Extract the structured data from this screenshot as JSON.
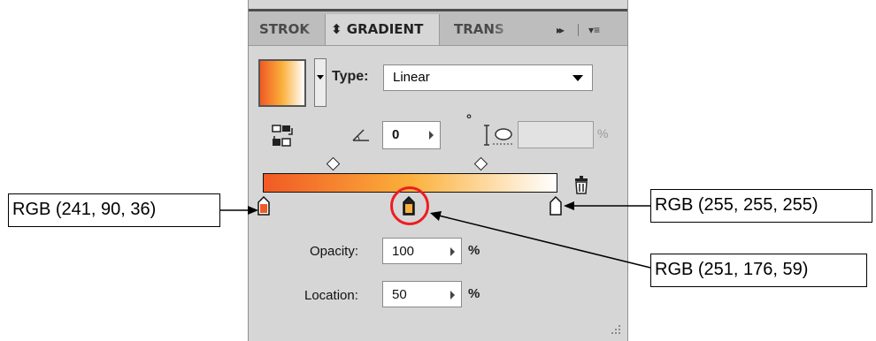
{
  "panel": {
    "tabs": [
      {
        "label": "STROK"
      },
      {
        "label": "⬍ GRADIENT"
      },
      {
        "label": "TRANS"
      }
    ],
    "icons": {
      "expand": "double-right-arrow-icon",
      "menu": "panel-menu-icon"
    }
  },
  "type_row": {
    "label": "Type:",
    "value": "Linear"
  },
  "angle_row": {
    "angle_value": "0",
    "degree_symbol": "°",
    "aspect_value": "",
    "aspect_unit": "%"
  },
  "gradient": {
    "stops": [
      {
        "color": "#f15a24",
        "location": 0
      },
      {
        "color": "#fbb03b",
        "location": 50,
        "selected": true
      },
      {
        "color": "#ffffff",
        "location": 100
      }
    ],
    "midpoints": [
      50,
      50
    ]
  },
  "opacity": {
    "label": "Opacity:",
    "value": "100",
    "unit": "%"
  },
  "location": {
    "label": "Location:",
    "value": "50",
    "unit": "%"
  },
  "annotations": {
    "left": "RGB (241, 90, 36)",
    "right_top": "RGB (255, 255, 255)",
    "right_bottom": "RGB (251, 176, 59)"
  },
  "colors": {
    "panel_bg": "#d6d6d6",
    "highlight_circle": "#ee1c24",
    "stop_start": "#f15a24",
    "stop_mid": "#fbb03b",
    "stop_end": "#ffffff"
  }
}
